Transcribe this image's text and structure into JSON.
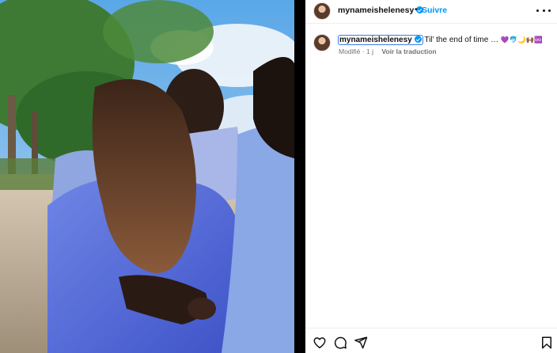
{
  "post": {
    "author": "mynameishelenesy",
    "verified": true,
    "follow_label": "Suivre",
    "separator": "•",
    "more_icon": "more-horizontal-icon"
  },
  "caption": {
    "username": "mynameishelenesy",
    "text": "Til’ the end of time …",
    "emojis": "💜🐬🌙🙌🏾♾️",
    "edited_label": "Modifié",
    "time_separator": "·",
    "time": "1 j",
    "translate_label": "Voir la traduction"
  },
  "actions": {
    "like_icon": "heart-icon",
    "comment_icon": "comment-icon",
    "share_icon": "send-icon",
    "save_icon": "bookmark-icon"
  },
  "colors": {
    "accent": "#0095f6",
    "muted": "#737373",
    "focus_outline": "#3b7be6"
  }
}
